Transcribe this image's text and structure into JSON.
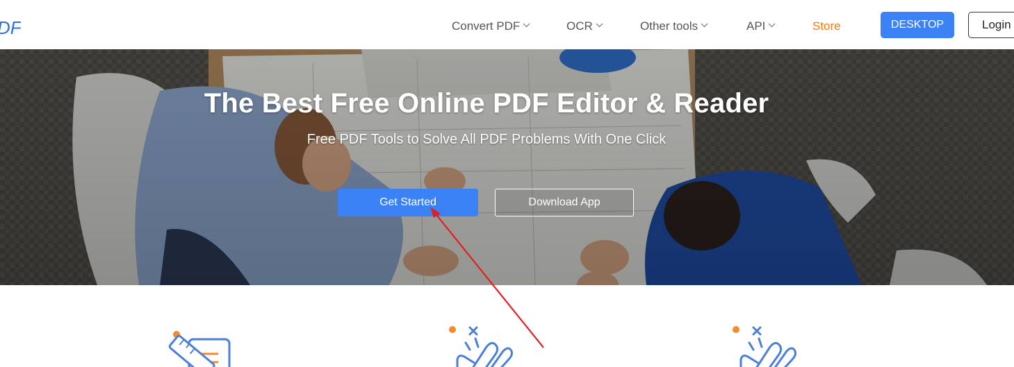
{
  "header": {
    "logo_text": "DF",
    "nav": [
      {
        "label": "Convert PDF",
        "has_dropdown": true
      },
      {
        "label": "OCR",
        "has_dropdown": true
      },
      {
        "label": "Other tools",
        "has_dropdown": true
      },
      {
        "label": "API",
        "has_dropdown": true
      },
      {
        "label": "Store",
        "has_dropdown": false
      }
    ],
    "desktop_label": "DESKTOP",
    "login_label": "Login"
  },
  "hero": {
    "title": "The Best Free Online PDF Editor & Reader",
    "subtitle": "Free PDF Tools to Solve All PDF Problems With One Click",
    "get_started_label": "Get Started",
    "download_label": "Download App"
  },
  "features": {
    "icons": [
      "ruler-list-icon",
      "hand-sparkle-icon",
      "hand-sparkle-icon"
    ]
  },
  "colors": {
    "accent_blue": "#3b82f6",
    "store_orange": "#f27a1a",
    "icon_blue": "#4a7fd9",
    "icon_orange": "#f28a2e",
    "annotation_red": "#e02020"
  }
}
